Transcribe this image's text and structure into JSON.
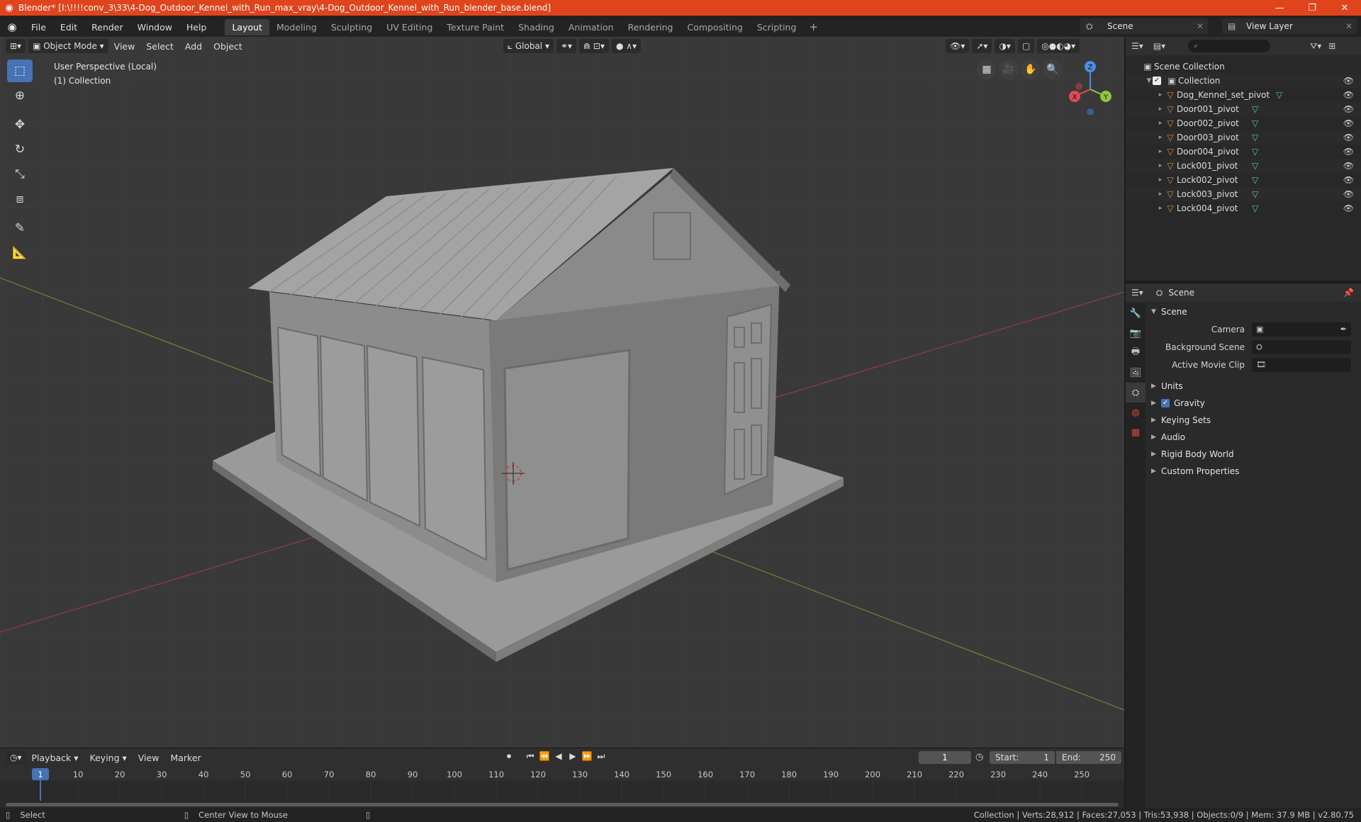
{
  "window": {
    "title": "Blender* [I:\\!!!!conv_3\\33\\4-Dog_Outdoor_Kennel_with_Run_max_vray\\4-Dog_Outdoor_Kennel_with_Run_blender_base.blend]",
    "minimize": "—",
    "maximize": "❐",
    "close": "✕"
  },
  "menu": [
    "File",
    "Edit",
    "Render",
    "Window",
    "Help"
  ],
  "workspaces": [
    "Layout",
    "Modeling",
    "Sculpting",
    "UV Editing",
    "Texture Paint",
    "Shading",
    "Animation",
    "Rendering",
    "Compositing",
    "Scripting"
  ],
  "active_workspace": "Layout",
  "scene_selector": "Scene",
  "view_layer": "View Layer",
  "viewport": {
    "mode": "Object Mode",
    "menus": [
      "View",
      "Select",
      "Add",
      "Object"
    ],
    "transform_orientation": "Global",
    "perspective_label": "User Perspective (Local)",
    "collection_label": "(1) Collection",
    "gizmo": {
      "x": "X",
      "y": "Y",
      "z": "Z"
    }
  },
  "icons": {
    "blender": "blender-logo-icon",
    "select": "select-box-icon",
    "cursor": "cursor-icon",
    "move": "move-icon",
    "rotate": "rotate-icon",
    "scale": "scale-icon",
    "transform": "transform-icon",
    "annotate": "annotate-icon",
    "measure": "measure-icon"
  },
  "outliner": {
    "root": "Scene Collection",
    "collection": "Collection",
    "objects": [
      "Dog_Kennel_set_pivot",
      "Door001_pivot",
      "Door002_pivot",
      "Door003_pivot",
      "Door004_pivot",
      "Lock001_pivot",
      "Lock002_pivot",
      "Lock003_pivot",
      "Lock004_pivot"
    ]
  },
  "properties": {
    "context": "Scene",
    "panel_title": "Scene",
    "camera_label": "Camera",
    "background_scene_label": "Background Scene",
    "active_movie_clip_label": "Active Movie Clip",
    "sections": [
      "Units",
      "Gravity",
      "Keying Sets",
      "Audio",
      "Rigid Body World",
      "Custom Properties"
    ]
  },
  "timeline": {
    "menus": [
      "Playback",
      "Keying",
      "View",
      "Marker"
    ],
    "current_frame": "1",
    "start_label": "Start:",
    "start": "1",
    "end_label": "End:",
    "end": "250",
    "ticks": [
      "1",
      "10",
      "20",
      "30",
      "40",
      "50",
      "60",
      "70",
      "80",
      "90",
      "100",
      "110",
      "120",
      "130",
      "140",
      "150",
      "160",
      "170",
      "180",
      "190",
      "200",
      "210",
      "220",
      "230",
      "240",
      "250"
    ]
  },
  "statusbar": {
    "left": "Select",
    "middle": "Center View to Mouse",
    "right": "Collection | Verts:28,912 | Faces:27,053 | Tris:53,938 | Objects:0/9 | Mem: 37.9 MB | v2.80.75"
  },
  "colors": {
    "titlebar": "#e0441c",
    "accent": "#4772b3",
    "x_axis": "#e24a57",
    "y_axis": "#8ec63f",
    "z_axis": "#4a8fe2"
  }
}
